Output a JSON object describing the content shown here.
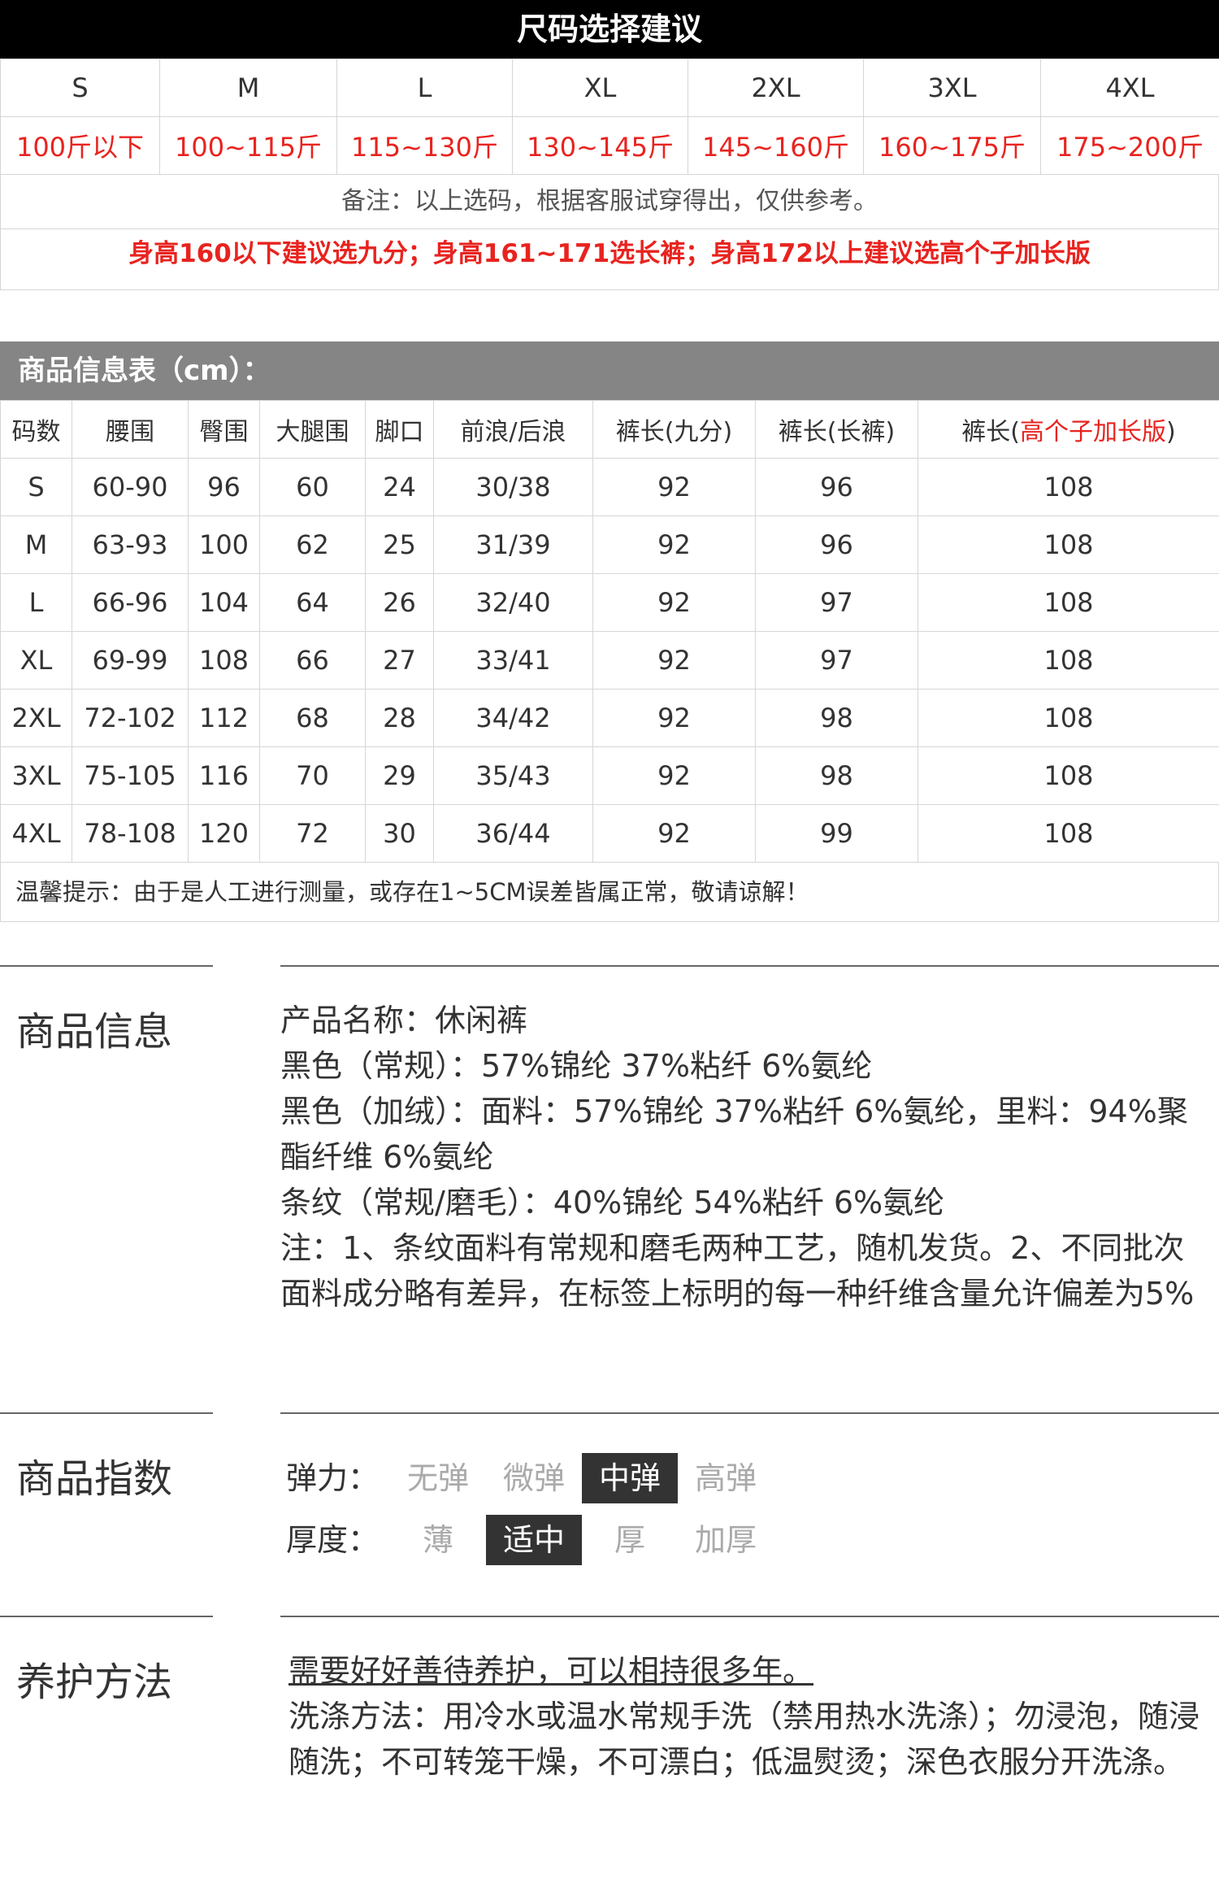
{
  "size_suggest": {
    "title": "尺码选择建议",
    "sizes": [
      "S",
      "M",
      "L",
      "XL",
      "2XL",
      "3XL",
      "4XL"
    ],
    "weights": [
      "100斤以下",
      "100~115斤",
      "115~130斤",
      "130~145斤",
      "145~160斤",
      "160~175斤",
      "175~200斤"
    ],
    "note": "备注：以上选码，根据客服试穿得出，仅供参考。",
    "height_note": "身高160以下建议选九分；身高161~171选长裤；身高172以上建议选高个子加长版"
  },
  "info_table": {
    "title": "商品信息表（cm）：",
    "headers": [
      "码数",
      "腰围",
      "臀围",
      "大腿围",
      "脚口",
      "前浪/后浪",
      "裤长(九分)",
      "裤长(长裤)"
    ],
    "last_header_prefix": "裤长(",
    "last_header_red": "高个子加长版",
    "last_header_suffix": ")",
    "rows": [
      [
        "S",
        "60-90",
        "96",
        "60",
        "24",
        "30/38",
        "92",
        "96",
        "108"
      ],
      [
        "M",
        "63-93",
        "100",
        "62",
        "25",
        "31/39",
        "92",
        "96",
        "108"
      ],
      [
        "L",
        "66-96",
        "104",
        "64",
        "26",
        "32/40",
        "92",
        "97",
        "108"
      ],
      [
        "XL",
        "69-99",
        "108",
        "66",
        "27",
        "33/41",
        "92",
        "97",
        "108"
      ],
      [
        "2XL",
        "72-102",
        "112",
        "68",
        "28",
        "34/42",
        "92",
        "98",
        "108"
      ],
      [
        "3XL",
        "75-105",
        "116",
        "70",
        "29",
        "35/43",
        "92",
        "98",
        "108"
      ],
      [
        "4XL",
        "78-108",
        "120",
        "72",
        "30",
        "36/44",
        "92",
        "99",
        "108"
      ]
    ],
    "tip": "温馨提示：由于是人工进行测量，或存在1~5CM误差皆属正常，敬请谅解！"
  },
  "product_info": {
    "title": "商品信息",
    "lines": [
      " 产品名称：休闲裤",
      "黑色（常规）：57%锦纶 37%粘纤 6%氨纶",
      "黑色（加绒）：面料：57%锦纶 37%粘纤 6%氨纶，里料：94%聚酯纤维 6%氨纶",
      "条纹（常规/磨毛）：40%锦纶 54%粘纤 6%氨纶",
      "注：1、条纹面料有常规和磨毛两种工艺，随机发货。2、不同批次面料成分略有差异，在标签上标明的每一种纤维含量允许偏差为5%"
    ]
  },
  "product_index": {
    "title": "商品指数",
    "elasticity": {
      "label": "弹力：",
      "options": [
        "无弹",
        "微弹",
        "中弹",
        "高弹"
      ],
      "selected": "中弹"
    },
    "thickness": {
      "label": "厚度：",
      "options": [
        "薄",
        "适中",
        "厚",
        "加厚"
      ],
      "selected": "适中"
    }
  },
  "care": {
    "title": "养护方法",
    "lead": "需要好好善待养护，可以相持很多年。",
    "body": "洗涤方法：用冷水或温水常规手洗（禁用热水洗涤）；勿浸泡，随浸随洗；不可转笼干燥，不可漂白；低温熨烫；深色衣服分开洗涤。"
  }
}
